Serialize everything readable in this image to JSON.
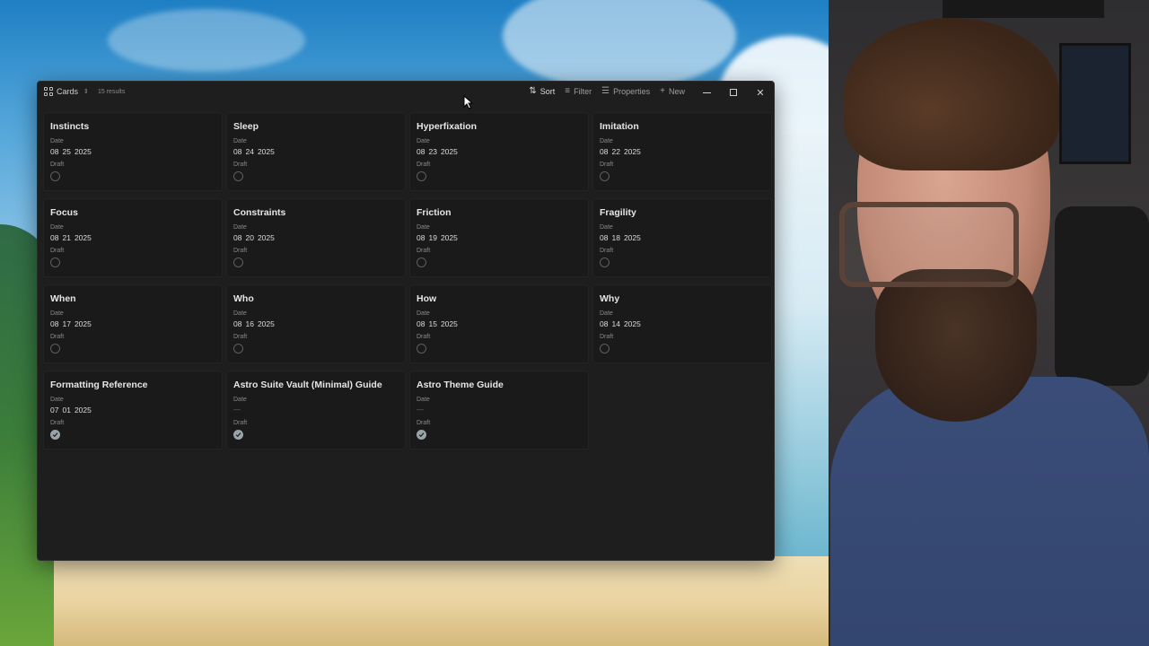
{
  "toolbar": {
    "view_label": "Cards",
    "results": "15 results",
    "sort_label": "Sort",
    "filter_label": "Filter",
    "properties_label": "Properties",
    "new_label": "New"
  },
  "cards": [
    {
      "title": "Instincts",
      "date_label": "Date",
      "month": "08",
      "day": "25",
      "year": "2025",
      "draft_label": "Draft",
      "draft": false
    },
    {
      "title": "Sleep",
      "date_label": "Date",
      "month": "08",
      "day": "24",
      "year": "2025",
      "draft_label": "Draft",
      "draft": false
    },
    {
      "title": "Hyperfixation",
      "date_label": "Date",
      "month": "08",
      "day": "23",
      "year": "2025",
      "draft_label": "Draft",
      "draft": false
    },
    {
      "title": "Imitation",
      "date_label": "Date",
      "month": "08",
      "day": "22",
      "year": "2025",
      "draft_label": "Draft",
      "draft": false
    },
    {
      "title": "Focus",
      "date_label": "Date",
      "month": "08",
      "day": "21",
      "year": "2025",
      "draft_label": "Draft",
      "draft": false
    },
    {
      "title": "Constraints",
      "date_label": "Date",
      "month": "08",
      "day": "20",
      "year": "2025",
      "draft_label": "Draft",
      "draft": false
    },
    {
      "title": "Friction",
      "date_label": "Date",
      "month": "08",
      "day": "19",
      "year": "2025",
      "draft_label": "Draft",
      "draft": false
    },
    {
      "title": "Fragility",
      "date_label": "Date",
      "month": "08",
      "day": "18",
      "year": "2025",
      "draft_label": "Draft",
      "draft": false
    },
    {
      "title": "When",
      "date_label": "Date",
      "month": "08",
      "day": "17",
      "year": "2025",
      "draft_label": "Draft",
      "draft": false
    },
    {
      "title": "Who",
      "date_label": "Date",
      "month": "08",
      "day": "16",
      "year": "2025",
      "draft_label": "Draft",
      "draft": false
    },
    {
      "title": "How",
      "date_label": "Date",
      "month": "08",
      "day": "15",
      "year": "2025",
      "draft_label": "Draft",
      "draft": false
    },
    {
      "title": "Why",
      "date_label": "Date",
      "month": "08",
      "day": "14",
      "year": "2025",
      "draft_label": "Draft",
      "draft": false
    },
    {
      "title": "Formatting Reference",
      "date_label": "Date",
      "month": "07",
      "day": "01",
      "year": "2025",
      "draft_label": "Draft",
      "draft": true
    },
    {
      "title": "Astro Suite Vault (Minimal) Guide",
      "date_label": "Date",
      "empty_date": "—",
      "draft_label": "Draft",
      "draft": true
    },
    {
      "title": "Astro Theme Guide",
      "date_label": "Date",
      "empty_date": "—",
      "draft_label": "Draft",
      "draft": true
    }
  ],
  "icons": {
    "view": "grid-icon",
    "sort": "sort-arrows-icon",
    "filter": "filter-lines-icon",
    "properties": "list-icon",
    "new": "plus-icon",
    "minimize": "minimize-icon",
    "maximize": "maximize-icon",
    "close": "close-icon",
    "checked": "check-icon"
  }
}
